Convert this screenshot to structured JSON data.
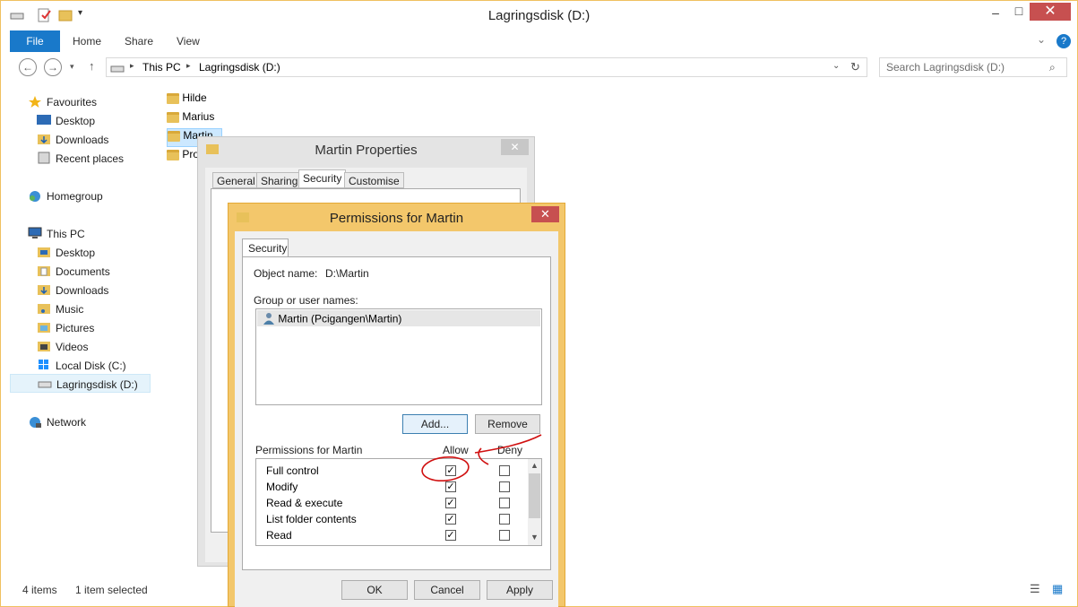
{
  "window": {
    "title": "Lagringsdisk (D:)",
    "minimize": "–",
    "maximize": "□",
    "close": "✕"
  },
  "ribbon": {
    "file": "File",
    "home": "Home",
    "share": "Share",
    "view": "View"
  },
  "address": {
    "path": [
      "This PC",
      "Lagringsdisk (D:)"
    ],
    "search_placeholder": "Search Lagringsdisk (D:)"
  },
  "nav": {
    "favourites": "Favourites",
    "fav_items": [
      "Desktop",
      "Downloads",
      "Recent places"
    ],
    "homegroup": "Homegroup",
    "thispc": "This PC",
    "pc_items": [
      "Desktop",
      "Documents",
      "Downloads",
      "Music",
      "Pictures",
      "Videos",
      "Local Disk (C:)",
      "Lagringsdisk (D:)"
    ],
    "network": "Network"
  },
  "folders": [
    "Hilde",
    "Marius",
    "Martin",
    "Pro"
  ],
  "status": {
    "items": "4 items",
    "selected": "1 item selected"
  },
  "props": {
    "title": "Martin Properties",
    "tabs": [
      "General",
      "Sharing",
      "Security",
      "Customise"
    ],
    "close": "✕"
  },
  "perm": {
    "title": "Permissions for Martin",
    "close": "✕",
    "tab": "Security",
    "object_label": "Object name:",
    "object_value": "D:\\Martin",
    "group_label": "Group or user names:",
    "user": "Martin (Pcigangen\\Martin)",
    "add": "Add...",
    "remove": "Remove",
    "perms_label": "Permissions for Martin",
    "allow": "Allow",
    "deny": "Deny",
    "rows": [
      {
        "name": "Full control",
        "allow": true,
        "deny": false
      },
      {
        "name": "Modify",
        "allow": true,
        "deny": false
      },
      {
        "name": "Read & execute",
        "allow": true,
        "deny": false
      },
      {
        "name": "List folder contents",
        "allow": true,
        "deny": false
      },
      {
        "name": "Read",
        "allow": true,
        "deny": false
      }
    ],
    "ok": "OK",
    "cancel": "Cancel",
    "apply": "Apply"
  },
  "colors": {
    "file_tab": "#1979ca",
    "close_red": "#c75050",
    "dialog_frame": "#f3c76b",
    "annotation": "#d01010"
  }
}
